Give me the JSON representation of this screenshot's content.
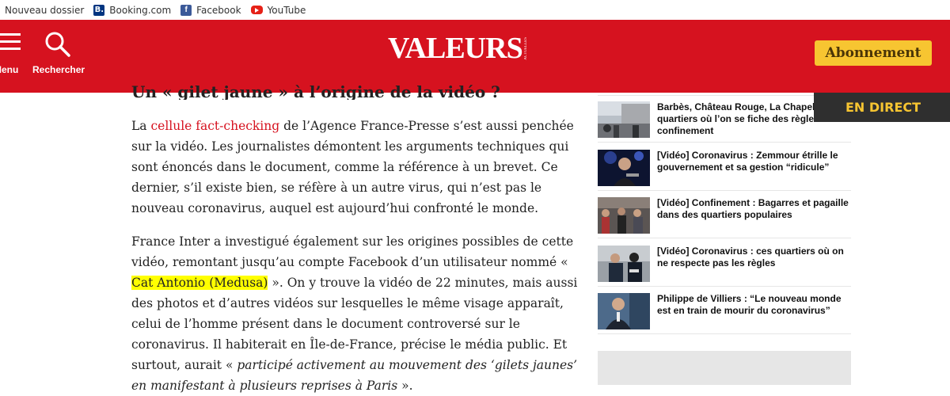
{
  "bookmarks": {
    "items": [
      {
        "label": "Nouveau dossier",
        "icon": "folder-icon"
      },
      {
        "label": "Booking.com",
        "icon": "booking-icon"
      },
      {
        "label": "Facebook",
        "icon": "facebook-icon"
      },
      {
        "label": "YouTube",
        "icon": "youtube-icon"
      }
    ]
  },
  "header": {
    "menu_label": "Menu",
    "search_label": "Rechercher",
    "logo": "VALEURS",
    "logo_sub": "ACTUELLES",
    "subscribe_label": "Abonnement",
    "bg_color": "#d6121f",
    "accent_color": "#f7c531"
  },
  "article": {
    "heading": "Un « gilet jaune » à l’origine de la vidéo ?",
    "p1": {
      "pre": "La ",
      "link": "cellule fact-checking",
      "post": " de l’Agence France-Presse s’est aussi penchée sur la vidéo. Les journalistes démontent les arguments techniques qui sont énoncés dans le document, comme la référence à un brevet. Ce dernier, s’il existe bien, se réfère à un autre virus, qui n’est pas le nouveau coronavirus, auquel est aujourd’hui confronté le monde."
    },
    "p2": {
      "pre": "France Inter a investigué également sur les origines possibles de cette vidéo, remontant jusqu’au compte Facebook d’un utilisateur nommé « ",
      "highlight": "Cat Antonio (Medusa)",
      "mid": " ». On y trouve la vidéo de 22 minutes, mais aussi des photos et d’autres vidéos sur lesquelles le même visage apparaît, celui de l’homme présent dans le document controversé sur le coronavirus. Il habiterait en Île-de-France, précise le média public. Et surtout, aurait « ",
      "italic": "participé activement au mouvement des ‘gilets jaunes’ en manifestant à plusieurs reprises à Paris",
      "end": " »."
    }
  },
  "live": {
    "label": "EN DIRECT"
  },
  "sidebar": {
    "items": [
      {
        "title": "Barbès, Château Rouge, La Chapelle : ces quartiers où l’on se fiche des règles du confinement"
      },
      {
        "title": "[Vidéo] Coronavirus : Zemmour étrille le gouvernement et sa gestion “ridicule”"
      },
      {
        "title": "[Vidéo] Confinement : Bagarres et pagaille dans des quartiers populaires"
      },
      {
        "title": "[Vidéo] Coronavirus : ces quartiers où on ne respecte pas les règles"
      },
      {
        "title": "Philippe de Villiers : “Le nouveau monde est en train de mourir du coronavirus”"
      }
    ]
  }
}
